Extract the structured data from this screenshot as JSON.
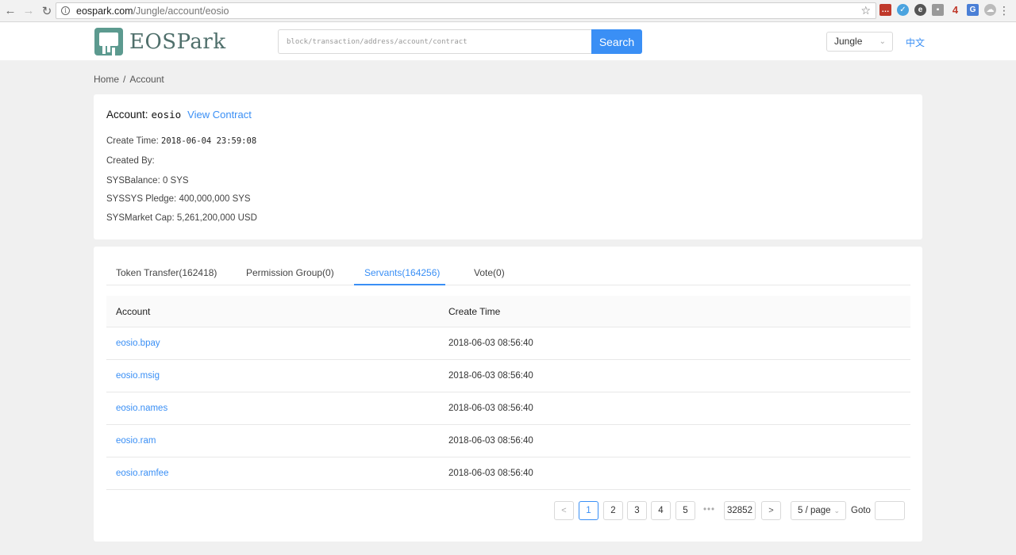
{
  "browser": {
    "url_host": "eospark.com",
    "url_path": "/Jungle/account/eosio"
  },
  "header": {
    "brand": "EOSPark",
    "search_placeholder": "block/transaction/address/account/contract",
    "search_label": "Search",
    "network": "Jungle",
    "language": "中文"
  },
  "breadcrumb": {
    "home": "Home",
    "separator": "/",
    "current": "Account"
  },
  "account": {
    "title_label": "Account:",
    "name": "eosio",
    "view_contract": "View Contract",
    "create_time_label": "Create Time:",
    "create_time": "2018-06-04 23:59:08",
    "created_by_label": "Created By:",
    "created_by": "",
    "balance_label": "SYSBalance:",
    "balance": "0 SYS",
    "pledge_label": "SYSSYS Pledge:",
    "pledge": "400,000,000 SYS",
    "market_cap_label": "SYSMarket Cap:",
    "market_cap": "5,261,200,000 USD"
  },
  "tabs": [
    {
      "label": "Token Transfer(162418)",
      "active": false
    },
    {
      "label": "Permission Group(0)",
      "active": false
    },
    {
      "label": "Servants(164256)",
      "active": true
    },
    {
      "label": "Vote(0)",
      "active": false
    }
  ],
  "table": {
    "columns": [
      "Account",
      "Create Time"
    ],
    "rows": [
      {
        "account": "eosio.bpay",
        "time": "2018-06-03 08:56:40"
      },
      {
        "account": "eosio.msig",
        "time": "2018-06-03 08:56:40"
      },
      {
        "account": "eosio.names",
        "time": "2018-06-03 08:56:40"
      },
      {
        "account": "eosio.ram",
        "time": "2018-06-03 08:56:40"
      },
      {
        "account": "eosio.ramfee",
        "time": "2018-06-03 08:56:40"
      }
    ]
  },
  "pagination": {
    "prev": "<",
    "pages": [
      "1",
      "2",
      "3",
      "4",
      "5"
    ],
    "current_page": "1",
    "ellipsis": "•••",
    "last_page": "32852",
    "next": ">",
    "page_size": "5 / page",
    "goto_label": "Goto"
  },
  "colors": {
    "accent": "#3a8ff5",
    "brand": "#5c9a8f"
  }
}
